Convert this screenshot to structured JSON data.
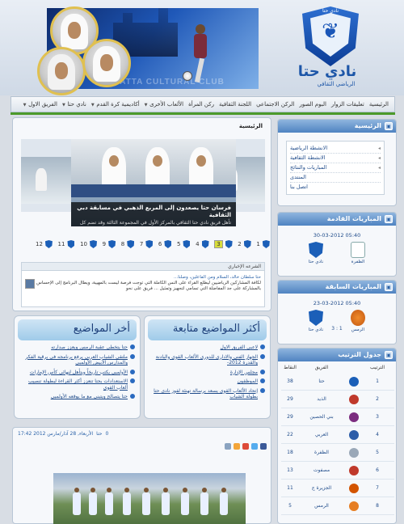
{
  "header": {
    "banner_caption": "HATTA CULTURAL CLUB",
    "logo_arc": "نادي حتا",
    "club_name": "نادي حتا",
    "club_subtitle": "الرياضي الثقافي"
  },
  "nav": {
    "items": [
      {
        "label": "الرئيسية",
        "dropdown": false
      },
      {
        "label": "تعليقات الزوار",
        "dropdown": false
      },
      {
        "label": "البوم الصور",
        "dropdown": false
      },
      {
        "label": "الركن الاجتماعي",
        "dropdown": false
      },
      {
        "label": "اللجنة الثقافية",
        "dropdown": false
      },
      {
        "label": "ركن المرأة",
        "dropdown": false
      },
      {
        "label": "الألعاب الأخرى",
        "dropdown": true
      },
      {
        "label": "أكاديمية كرة القدم",
        "dropdown": true
      },
      {
        "label": "نادي حتا",
        "dropdown": true
      },
      {
        "label": "الفريق الاول",
        "dropdown": true
      }
    ]
  },
  "main": {
    "title": "الرئيسية",
    "slide_caption_title": "فرسان حتا يصعدون إلى المربع الذهبي في مسابقة دبي الثقافية",
    "slide_caption_body": "تأهل فريق نادي حتا الثقافي بالمركز الأول في المجموعة الثالثة وقد تضم كل من...",
    "pager": [
      "12",
      "11",
      "10",
      "9",
      "8",
      "7",
      "6",
      "5",
      "4",
      "3",
      "2",
      "1"
    ],
    "pager_active": "3",
    "comments_head": "الشرعه الإخباري",
    "comment_meta": "حتا سلطان خالد، السلام ومن الفاعلين، وصلنا...",
    "comment_text": "لكافة المشاركين الرياضيين ليطلع القراء على النس الكاملة التي توجت فرصة ليست بالمهيية، ويطال البرنامج إلى الإحساس بالمشاركة على جد المفاضلة التي تسامي لتجهيز وتمثيل ... فريق على نحو"
  },
  "topics_popular": {
    "title": "أكثر المواضيع متابعة",
    "items": [
      "لاعبي الفريق الاول",
      "الجهاز الفني والاداري للدوري الألعاب القوى والبادنة والقدرة 2012-",
      "مجلس الإدارة",
      "الموظفون",
      "إتحاد الألعاب القوى يسعد برسالة تهنئة لفوز نادي حتا بطولة الشباب"
    ]
  },
  "topics_latest": {
    "title": "أخر المواضيع",
    "items": [
      "حتا يتخطى عقبة الرمس ويعزز صدارته",
      "ملتقى الشباب العربي يرفع برنامجه في برقية الفكر والمدارس الأبيض الأولمبي",
      "الأولمبي يكتب تاريخاً ويتأهل لنهائي كأس الإمارات",
      "الاستعدادات بحتا تتعزز أكثر القراءة لبطولة تنصيب ألعاب القوى",
      "حتا يتصالح ويتبنى مع ما يوقعه الأولمبي"
    ]
  },
  "post": {
    "date": "الأربعاء, 28 آذار/مارس 2012 17:42",
    "meta_1": "حتا",
    "meta_2": "0"
  },
  "sidebar": {
    "home": {
      "title": "الرئيسية",
      "items": [
        {
          "label": "الانشطة الرياضية",
          "arrow": true
        },
        {
          "label": "الانشطة الثقافية",
          "arrow": true
        },
        {
          "label": "المباريات والنتائج",
          "arrow": true
        },
        {
          "label": "المنتدى",
          "arrow": false
        },
        {
          "label": "اتصل بنا",
          "arrow": false
        }
      ]
    },
    "next_match": {
      "title": "المباريات القادمة",
      "date": "30-03-2012 05:40",
      "home": "نادي حتا",
      "away": "الظفرة"
    },
    "prev_match": {
      "title": "المباريات السابقة",
      "date": "23-03-2012 05:40",
      "home": "نادي حتا",
      "away": "الرمس",
      "score": "3 : 1"
    },
    "table": {
      "title": "جدول الترتيب",
      "headers": {
        "pts": "النقاط",
        "team": "الفريق",
        "rank": "الترتيب"
      },
      "rows": [
        {
          "pts": "38",
          "team": "حتا",
          "rank": "1",
          "color": "#1b5fb8"
        },
        {
          "pts": "29",
          "team": "الذيد",
          "rank": "2",
          "color": "#c0392b"
        },
        {
          "pts": "29",
          "team": "بني الحصين",
          "rank": "3",
          "color": "#7b2c7f"
        },
        {
          "pts": "22",
          "team": "العربي",
          "rank": "4",
          "color": "#2d5da8"
        },
        {
          "pts": "18",
          "team": "الظفرة",
          "rank": "5",
          "color": "#9aa8b8"
        },
        {
          "pts": "13",
          "team": "مصفوت",
          "rank": "6",
          "color": "#c0392b"
        },
        {
          "pts": "11",
          "team": "الجزيرة ج",
          "rank": "7",
          "color": "#d35400"
        },
        {
          "pts": "5",
          "team": "الرمس",
          "rank": "8",
          "color": "#e67e22"
        }
      ]
    }
  }
}
